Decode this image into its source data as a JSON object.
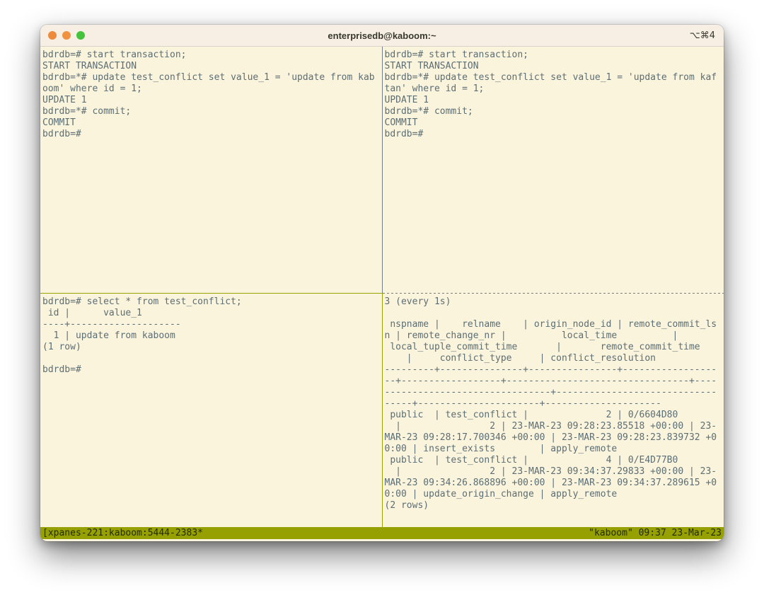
{
  "window": {
    "title": "enterprisedb@kaboom:~",
    "shortcut_hint": "⌥⌘4"
  },
  "colors": {
    "terminal_bg": "#fbf4dd",
    "terminal_fg": "#5b6e74",
    "titlebar_bg": "#f7efe3",
    "pane_border_inactive": "#70808b",
    "pane_border_active": "#9aa400",
    "status_bg": "#96a000",
    "status_fg": "#222b00",
    "traffic_close": "#ec8a3d",
    "traffic_minimize": "#ef9241",
    "traffic_zoom": "#44c33c"
  },
  "panes": {
    "top_left": {
      "lines": [
        "bdrdb=# start transaction;",
        "START TRANSACTION",
        "bdrdb=*# update test_conflict set value_1 = 'update from kab",
        "oom' where id = 1;",
        "UPDATE 1",
        "bdrdb=*# commit;",
        "COMMIT",
        "bdrdb=#"
      ]
    },
    "top_right": {
      "lines": [
        "bdrdb=# start transaction;",
        "START TRANSACTION",
        "bdrdb=*# update test_conflict set value_1 = 'update from kaf",
        "tan' where id = 1;",
        "UPDATE 1",
        "bdrdb=*# commit;",
        "COMMIT",
        "bdrdb=#"
      ]
    },
    "bottom_left": {
      "lines": [
        "bdrdb=# select * from test_conflict;",
        " id |      value_1",
        "----+--------------------",
        "  1 | update from kaboom",
        "(1 row)",
        "",
        "bdrdb=#"
      ]
    },
    "bottom_right": {
      "lines": [
        "3 (every 1s)",
        "",
        " nspname |    relname    | origin_node_id | remote_commit_ls",
        "n | remote_change_nr |          local_time          |",
        " local_tuple_commit_time       |       remote_commit_time",
        "    |     conflict_type     | conflict_resolution",
        "---------+---------------+----------------+-----------------",
        "--+------------------+---------------------------------+----",
        "------------------------------+-----------------------------",
        "-----+----------------------+---------------------",
        " public  | test_conflict |              2 | 0/6604D80",
        "  |                2 | 23-MAR-23 09:28:23.85518 +00:00 | 23-",
        "MAR-23 09:28:17.700346 +00:00 | 23-MAR-23 09:28:23.839732 +0",
        "0:00 | insert_exists        | apply_remote",
        " public  | test_conflict |              4 | 0/E4D77B0",
        "  |                2 | 23-MAR-23 09:34:37.29833 +00:00 | 23-",
        "MAR-23 09:34:26.868896 +00:00 | 23-MAR-23 09:34:37.289615 +0",
        "0:00 | update_origin_change | apply_remote",
        "(2 rows)"
      ]
    }
  },
  "status_bar": {
    "left": "[xpanes-221:kaboom:5444-2383*",
    "right": "\"kaboom\" 09:37 23-Mar-23"
  }
}
